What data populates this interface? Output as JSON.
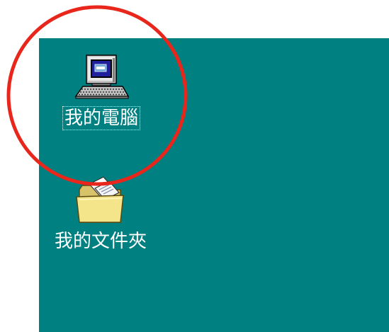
{
  "desktop": {
    "background_color": "#008080",
    "icons": [
      {
        "label": "我的電腦",
        "icon": "my-computer-icon",
        "selected": true
      },
      {
        "label": "我的文件夾",
        "icon": "my-documents-folder-icon",
        "selected": false
      }
    ]
  },
  "annotation": {
    "highlight_color": "#e8261c"
  }
}
